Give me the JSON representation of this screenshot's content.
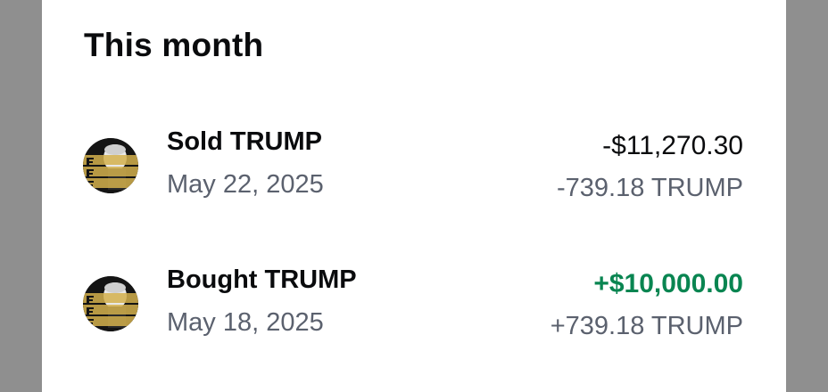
{
  "section": {
    "title": "This month"
  },
  "transactions": [
    {
      "title": "Sold TRUMP",
      "date": "May 22, 2025",
      "fiat_amount": "-$11,270.30",
      "crypto_amount": "-739.18 TRUMP",
      "icon": "trump-coin-icon",
      "icon_text": "FIGHT FIGHT FIGHT",
      "amount_color": "#0a0b0d"
    },
    {
      "title": "Bought TRUMP",
      "date": "May 18, 2025",
      "fiat_amount": "+$10,000.00",
      "crypto_amount": "+739.18 TRUMP",
      "icon": "trump-coin-icon",
      "icon_text": "FIGHT FIGHT FIGHT",
      "amount_color": "#098551"
    }
  ],
  "colors": {
    "background": "#8f8f8f",
    "card": "#ffffff",
    "primary_text": "#0a0b0d",
    "secondary_text": "#5b616e",
    "positive": "#098551",
    "coin_gold": "#d4b04c"
  }
}
